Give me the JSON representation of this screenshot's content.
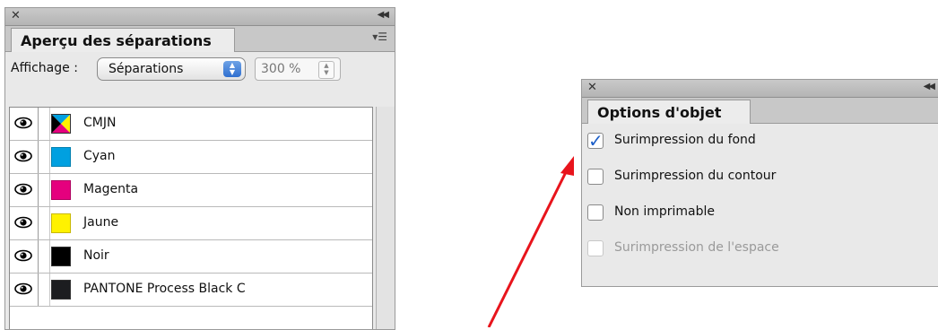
{
  "separations_panel": {
    "title": "Aperçu des séparations",
    "view_label": "Affichage :",
    "view_value": "Séparations",
    "zoom_value": "300 %",
    "rows": [
      {
        "name": "CMJN",
        "color": "cmyk"
      },
      {
        "name": "Cyan",
        "color": "#00a0e0"
      },
      {
        "name": "Magenta",
        "color": "#e5007e"
      },
      {
        "name": "Jaune",
        "color": "#fff200"
      },
      {
        "name": "Noir",
        "color": "#000000"
      },
      {
        "name": "PANTONE Process Black C",
        "color": "#1c1d20"
      }
    ]
  },
  "options_panel": {
    "title": "Options d'objet",
    "options": [
      {
        "label": "Surimpression du fond",
        "checked": true,
        "enabled": true
      },
      {
        "label": "Surimpression du contour",
        "checked": false,
        "enabled": true
      },
      {
        "label": "Non imprimable",
        "checked": false,
        "enabled": true
      },
      {
        "label": "Surimpression de l'espace",
        "checked": false,
        "enabled": false
      }
    ]
  },
  "annotation": {
    "arrow_color": "#e8141c"
  }
}
